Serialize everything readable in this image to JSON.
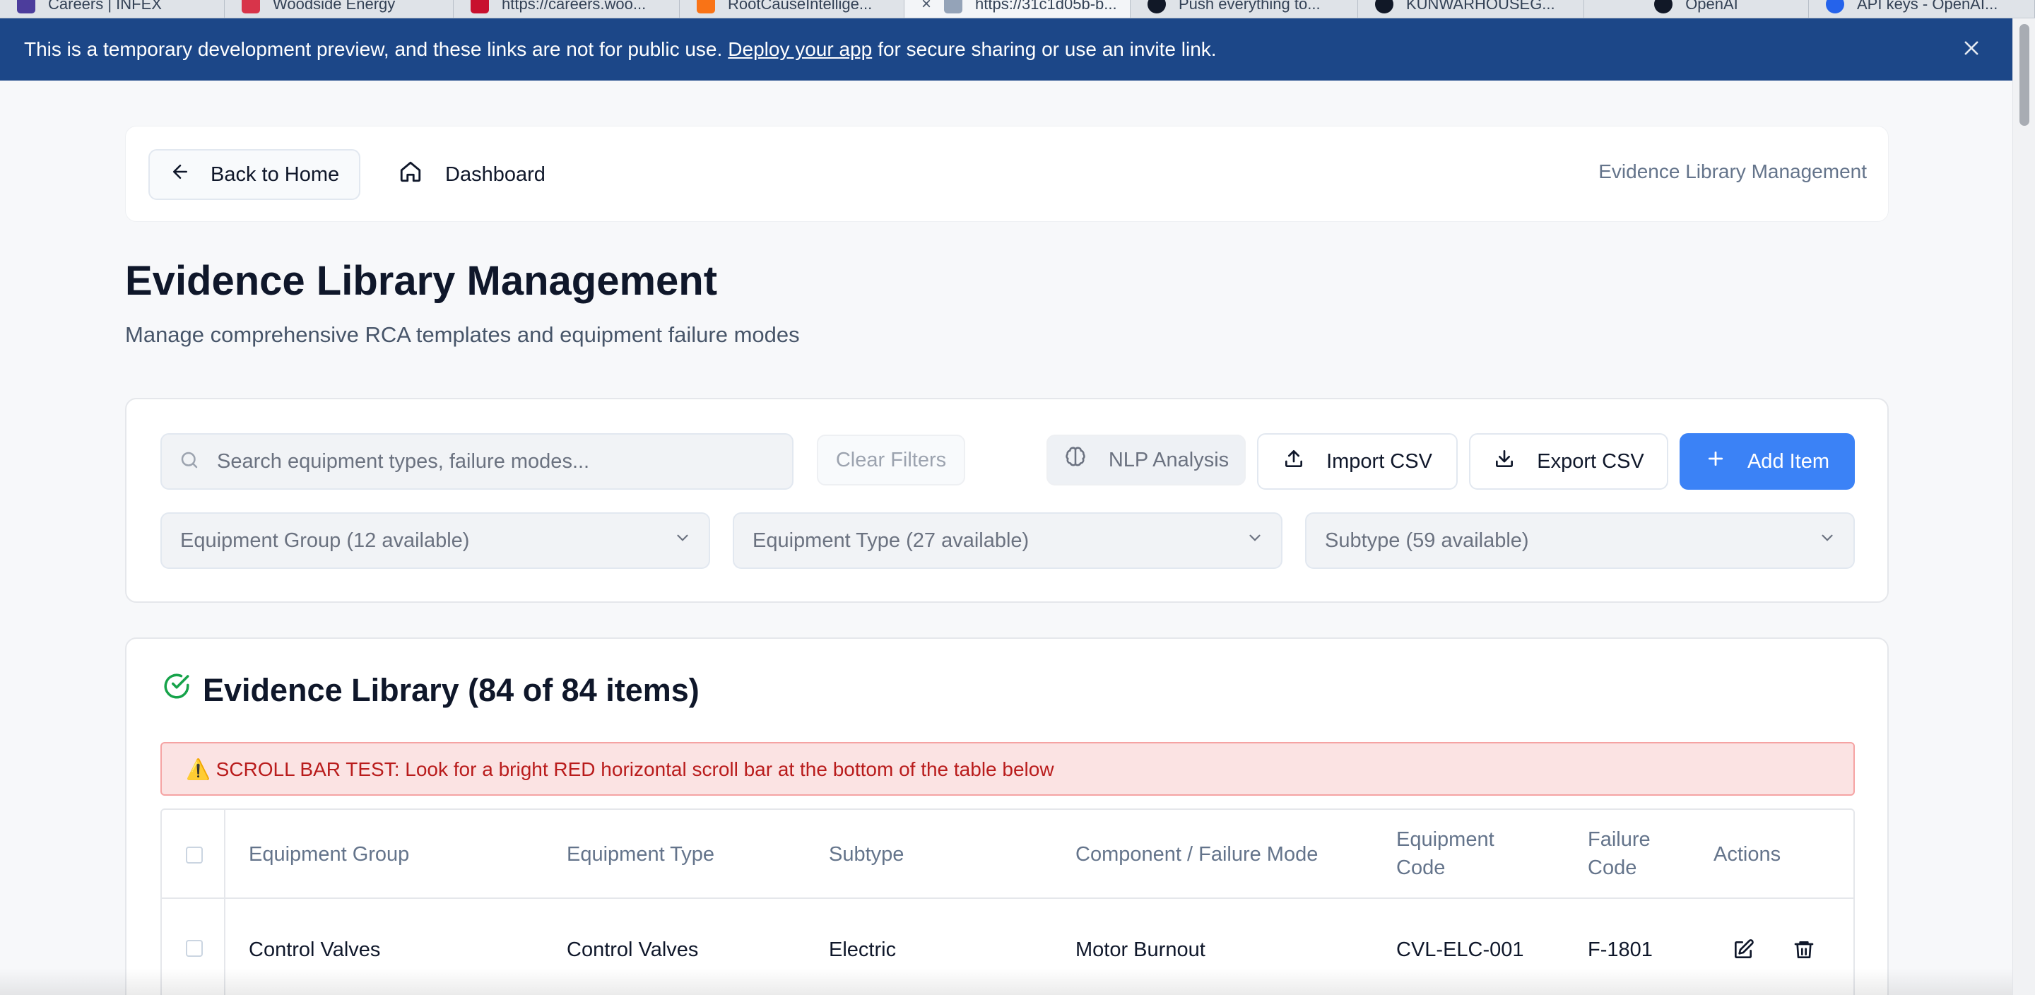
{
  "browser": {
    "tabs": [
      {
        "label": "Careers | INFEX",
        "color": "#4c3d9c"
      },
      {
        "label": "Woodside Energy",
        "color": "#d8344a"
      },
      {
        "label": "https://careers.woo...",
        "color": "#c8102e"
      },
      {
        "label": "RootCauseIntellige...",
        "color": "#f97316"
      },
      {
        "label": "https://31c1d05b-b...",
        "color": "#64748b"
      },
      {
        "label": "Push everything to...",
        "color": "#111827"
      },
      {
        "label": "KUNWARHOUSEG...",
        "color": "#111827"
      },
      {
        "label": "OpenAI",
        "color": "#111827"
      },
      {
        "label": "API keys - OpenAI...",
        "color": "#2563eb"
      }
    ]
  },
  "banner": {
    "text_before": "This is a temporary development preview, and these links are not for public use.",
    "link": "Deploy your app",
    "text_after": "for secure sharing or use an invite link."
  },
  "nav": {
    "back_label": "Back to Home",
    "dashboard_label": "Dashboard",
    "right_label": "Evidence Library Management"
  },
  "page": {
    "title": "Evidence Library Management",
    "subtitle": "Manage comprehensive RCA templates and equipment failure modes"
  },
  "filters": {
    "search_placeholder": "Search equipment types, failure modes...",
    "clear_label": "Clear Filters",
    "nlp_label": "NLP Analysis",
    "import_label": "Import CSV",
    "export_label": "Export CSV",
    "add_label": "Add Item",
    "group_select": "Equipment Group (12 available)",
    "type_select": "Equipment Type (27 available)",
    "subtype_select": "Subtype (59 available)"
  },
  "library": {
    "title": "Evidence Library (84 of 84 items)",
    "alert": "⚠️ SCROLL BAR TEST: Look for a bright RED horizontal scroll bar at the bottom of the table below",
    "columns": {
      "group": "Equipment Group",
      "type": "Equipment Type",
      "subtype": "Subtype",
      "component": "Component / Failure Mode",
      "equip_code_1": "Equipment",
      "equip_code_2": "Code",
      "fail_code_1": "Failure",
      "fail_code_2": "Code",
      "actions": "Actions"
    },
    "rows": [
      {
        "group": "Control Valves",
        "type": "Control Valves",
        "subtype": "Electric",
        "component": "Motor Burnout",
        "equip_code": "CVL-ELC-001",
        "fail_code": "F-1801"
      }
    ]
  },
  "colors": {
    "banner": "#1c4788",
    "primary": "#3b82f6",
    "alert_bg": "#fbe3e3",
    "alert_text": "#b91c1c",
    "success": "#16a34a"
  }
}
